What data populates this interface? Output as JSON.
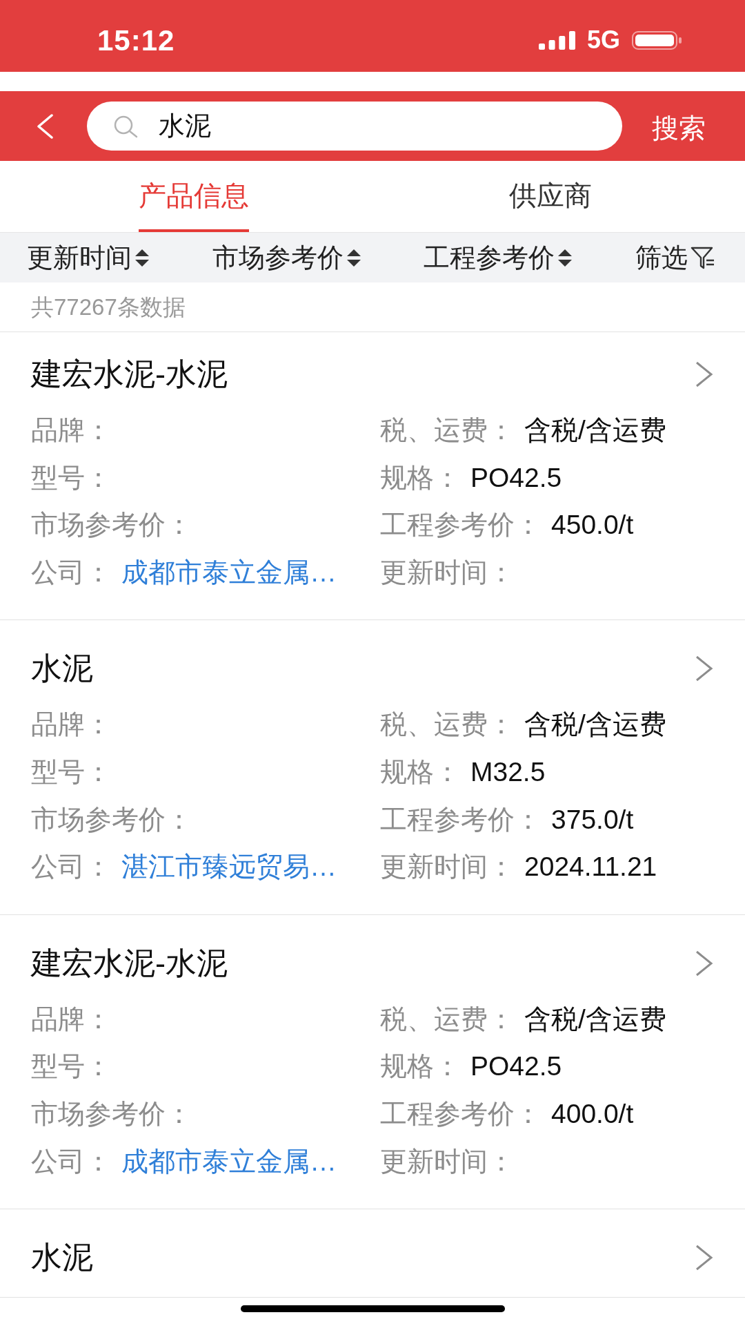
{
  "status_bar": {
    "time": "15:12",
    "network": "5G"
  },
  "search": {
    "query": "水泥",
    "button": "搜索"
  },
  "tabs": [
    {
      "label": "产品信息",
      "selected": true
    },
    {
      "label": "供应商",
      "selected": false
    }
  ],
  "sort_bar": [
    {
      "kind": "sort",
      "label": "更新时间"
    },
    {
      "kind": "sort",
      "label": "市场参考价"
    },
    {
      "kind": "sort",
      "label": "工程参考价"
    },
    {
      "kind": "filter",
      "label": "筛选"
    }
  ],
  "result_count": "共77267条数据",
  "products": [
    {
      "title": "建宏水泥-水泥",
      "fields": [
        {
          "label": "品牌："
        },
        {
          "label": "税、运费：",
          "value": "含税/含运费"
        },
        {
          "label": "型号："
        },
        {
          "label": "规格：",
          "value": "PO42.5"
        },
        {
          "label": "市场参考价："
        },
        {
          "label": "工程参考价：",
          "value": "450.0/t"
        },
        {
          "label": "公司：",
          "link": "成都市泰立金属…"
        },
        {
          "label": "更新时间："
        }
      ]
    },
    {
      "title": "水泥",
      "fields": [
        {
          "label": "品牌："
        },
        {
          "label": "税、运费：",
          "value": "含税/含运费"
        },
        {
          "label": "型号："
        },
        {
          "label": "规格：",
          "value": "M32.5"
        },
        {
          "label": "市场参考价："
        },
        {
          "label": "工程参考价：",
          "value": "375.0/t"
        },
        {
          "label": "公司：",
          "link": "湛江市臻远贸易…"
        },
        {
          "label": "更新时间：",
          "value": "2024.11.21"
        }
      ]
    },
    {
      "title": "建宏水泥-水泥",
      "fields": [
        {
          "label": "品牌："
        },
        {
          "label": "税、运费：",
          "value": "含税/含运费"
        },
        {
          "label": "型号："
        },
        {
          "label": "规格：",
          "value": "PO42.5"
        },
        {
          "label": "市场参考价："
        },
        {
          "label": "工程参考价：",
          "value": "400.0/t"
        },
        {
          "label": "公司：",
          "link": "成都市泰立金属…"
        },
        {
          "label": "更新时间："
        }
      ]
    },
    {
      "title": "水泥"
    }
  ]
}
